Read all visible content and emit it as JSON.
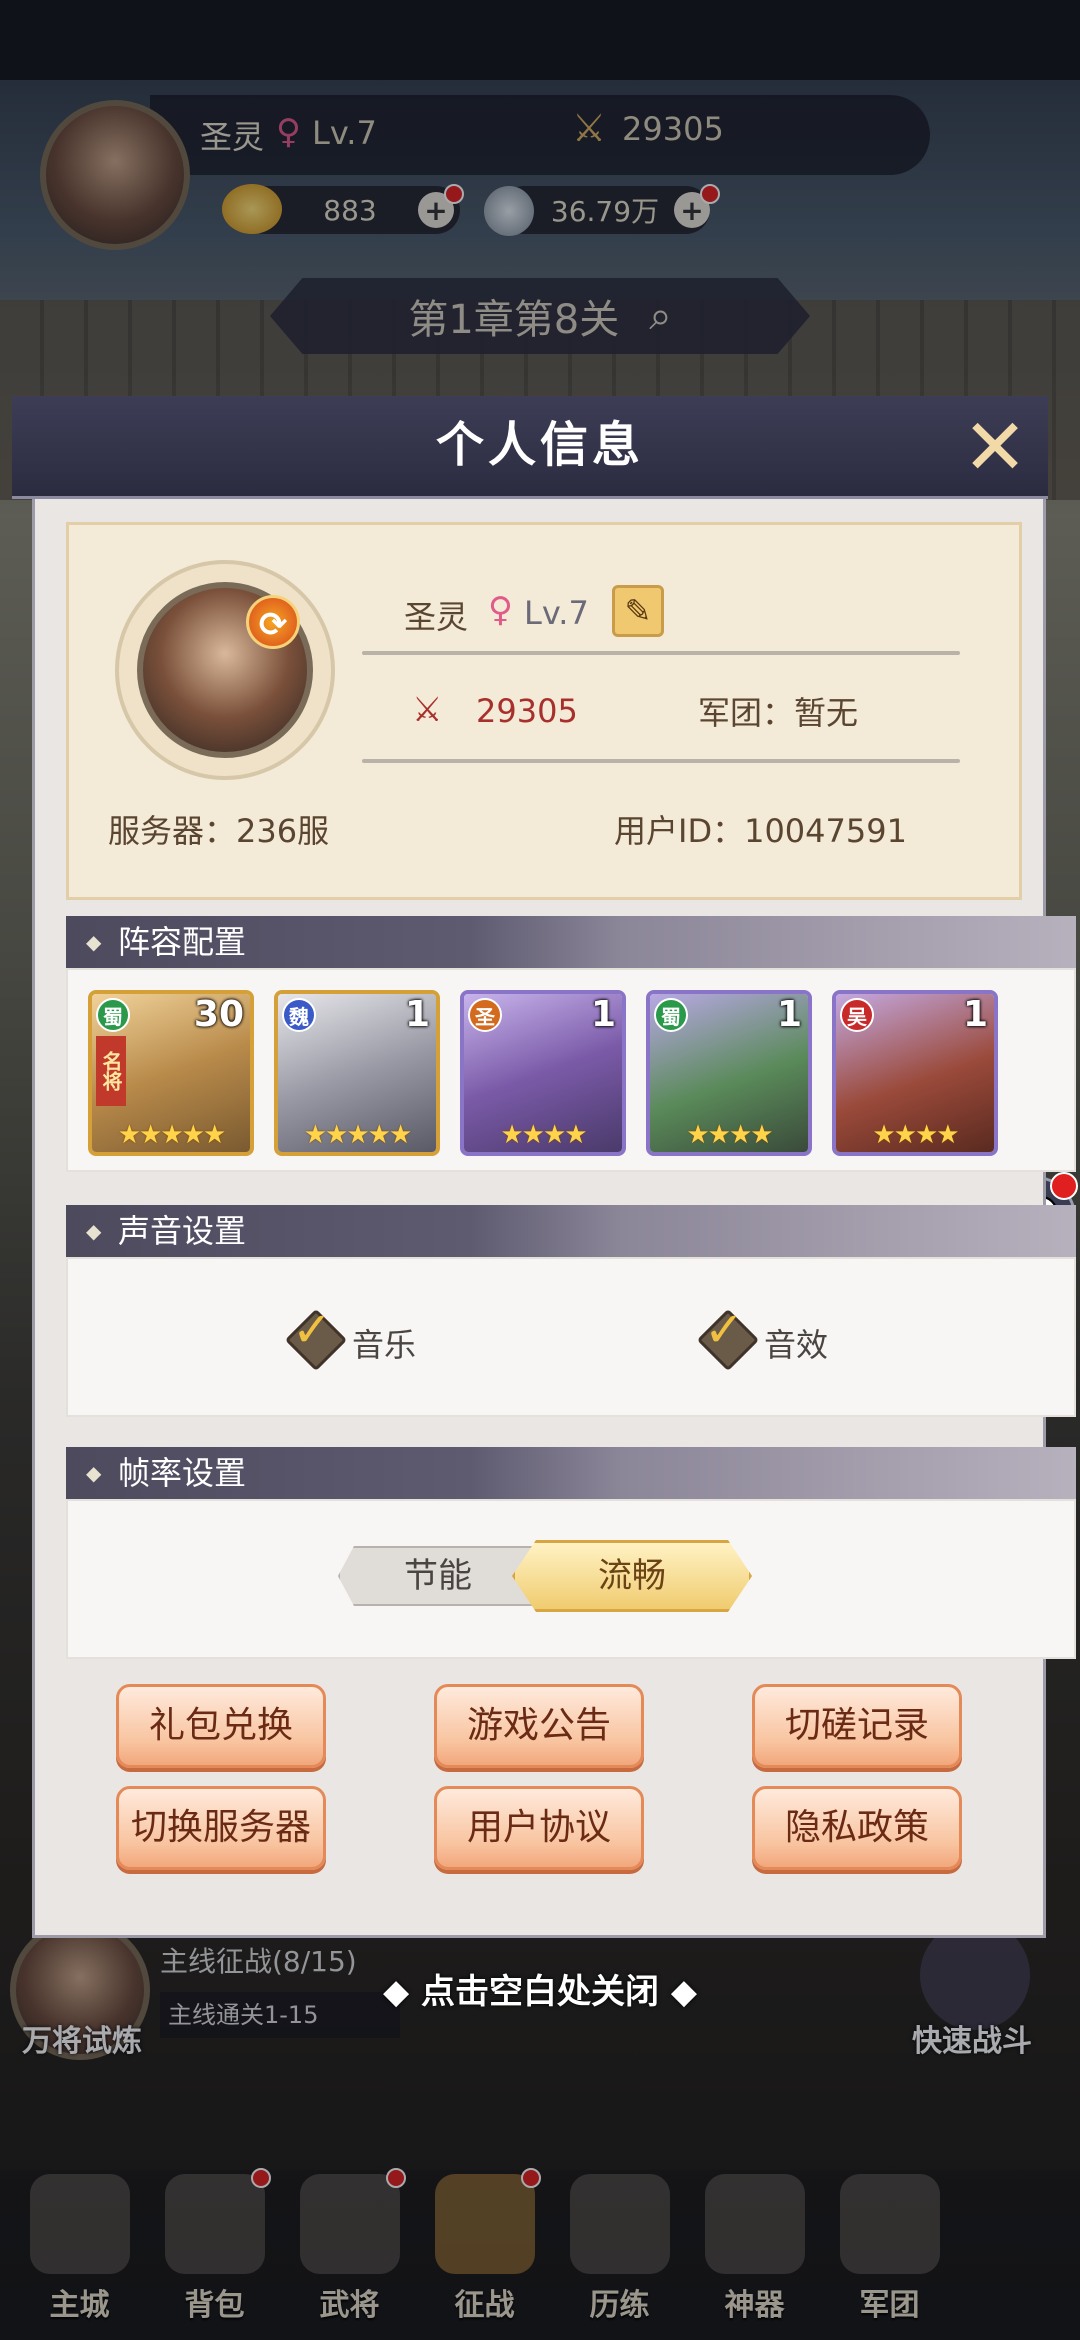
{
  "hud": {
    "player_name": "圣灵",
    "level": "Lv.7",
    "power": "29305",
    "gold": "883",
    "coins": "36.79万",
    "chapter": "第1章第8关"
  },
  "modal": {
    "title": "个人信息",
    "close_label": "✕"
  },
  "profile": {
    "name": "圣灵",
    "level": "Lv.7",
    "power": "29305",
    "legion": "军团：暂无",
    "server": "服务器：236服",
    "user_id": "用户ID：10047591"
  },
  "lineup": {
    "title": "阵容配置",
    "heroes": [
      {
        "faction": "蜀",
        "level": "30",
        "tag": "名将",
        "stars": "★★★★★"
      },
      {
        "faction": "魏",
        "level": "1",
        "stars": "★★★★★"
      },
      {
        "faction": "圣",
        "level": "1",
        "stars": "★★★★"
      },
      {
        "faction": "蜀",
        "level": "1",
        "stars": "★★★★"
      },
      {
        "faction": "吴",
        "level": "1",
        "stars": "★★★★"
      }
    ]
  },
  "sound": {
    "title": "声音设置",
    "music": "音乐",
    "effects": "音效"
  },
  "fps": {
    "title": "帧率设置",
    "save": "节能",
    "smooth": "流畅"
  },
  "buttons": {
    "gift": "礼包兑换",
    "notice": "游戏公告",
    "record": "切磋记录",
    "server": "切换服务器",
    "agreement": "用户协议",
    "privacy": "隐私政策"
  },
  "behind": {
    "trial": "万将试炼",
    "mainline": "主线征战(8/15)",
    "mainline_sub": "主线通关1-15",
    "quick_battle": "快速战斗",
    "close_hint": "点击空白处关闭"
  },
  "bottomnav": [
    "主城",
    "背包",
    "武将",
    "征战",
    "历练",
    "神器",
    "军团"
  ],
  "colors": {
    "header": "#2b2b40",
    "accent": "#f0cc70",
    "power_red": "#a8302c",
    "button": "#f8c4a0"
  }
}
